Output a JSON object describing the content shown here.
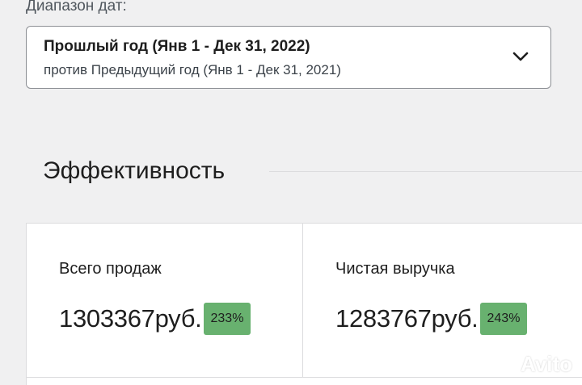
{
  "date_range": {
    "label": "Диапазон дат:",
    "primary": "Прошлый год (Янв 1 - Дек 31, 2022)",
    "secondary": "против Предыдущий год (Янв 1 - Дек 31, 2021)",
    "icon": "chevron-down-icon"
  },
  "performance": {
    "title": "Эффективность",
    "cards": [
      {
        "label": "Всего продаж",
        "value": "1303367руб.",
        "delta": "233%"
      },
      {
        "label": "Чистая выручка",
        "value": "1283767руб.",
        "delta": "243%"
      }
    ]
  },
  "watermark": {
    "text": "Avito"
  },
  "colors": {
    "badge_positive": "#68b16f",
    "background": "#f0f0f1",
    "card": "#ffffff",
    "border": "#dcdcde"
  }
}
